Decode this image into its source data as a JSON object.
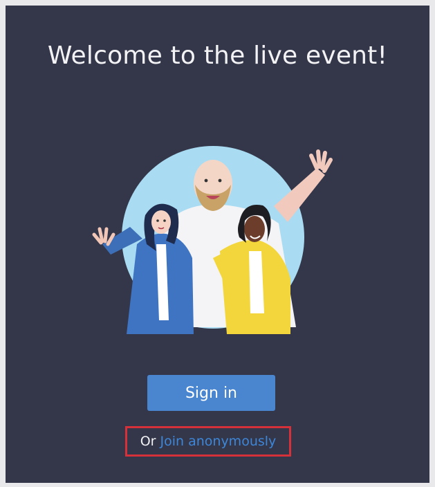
{
  "welcome": {
    "title": "Welcome to the live event!"
  },
  "illustration": {
    "icon": "welcome-people-illustration"
  },
  "actions": {
    "sign_in_label": "Sign in",
    "or_label": "Or",
    "join_anonymously_label": "Join anonymously"
  },
  "colors": {
    "background": "#34374a",
    "primary_button": "#4a86cf",
    "link": "#3d86d8",
    "highlight_box": "#d6313a"
  }
}
